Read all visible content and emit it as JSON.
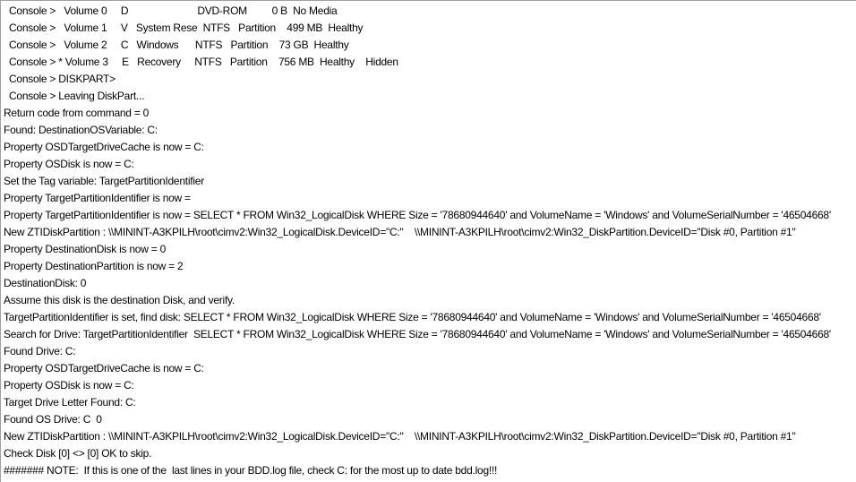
{
  "log_lines": [
    {
      "text": "Console >   Volume 0     D                         DVD-ROM         0 B  No Media",
      "console": true
    },
    {
      "text": "Console >   Volume 1     V   System Rese  NTFS   Partition    499 MB  Healthy",
      "console": true
    },
    {
      "text": "Console >   Volume 2     C   Windows      NTFS   Partition    73 GB  Healthy",
      "console": true
    },
    {
      "text": "Console > * Volume 3     E   Recovery     NTFS   Partition    756 MB  Healthy    Hidden",
      "console": true
    },
    {
      "text": "Console > DISKPART>",
      "console": true
    },
    {
      "text": "Console > Leaving DiskPart...",
      "console": true
    },
    {
      "text": "Return code from command = 0"
    },
    {
      "text": "Found: DestinationOSVariable: C:"
    },
    {
      "text": "Property OSDTargetDriveCache is now = C:"
    },
    {
      "text": "Property OSDisk is now = C:"
    },
    {
      "text": "Set the Tag variable: TargetPartitionIdentifier"
    },
    {
      "text": "Property TargetPartitionIdentifier is now = "
    },
    {
      "text": "Property TargetPartitionIdentifier is now = SELECT * FROM Win32_LogicalDisk WHERE Size = '78680944640' and VolumeName = 'Windows' and VolumeSerialNumber = '46504668'"
    },
    {
      "text": "New ZTIDiskPartition : \\\\MININT-A3KPILH\\root\\cimv2:Win32_LogicalDisk.DeviceID=\"C:\"    \\\\MININT-A3KPILH\\root\\cimv2:Win32_DiskPartition.DeviceID=\"Disk #0, Partition #1\""
    },
    {
      "text": "Property DestinationDisk is now = 0"
    },
    {
      "text": "Property DestinationPartition is now = 2"
    },
    {
      "text": "DestinationDisk: 0"
    },
    {
      "text": "Assume this disk is the destination Disk, and verify."
    },
    {
      "text": "TargetPartitionIdentifier is set, find disk: SELECT * FROM Win32_LogicalDisk WHERE Size = '78680944640' and VolumeName = 'Windows' and VolumeSerialNumber = '46504668'"
    },
    {
      "text": "Search for Drive: TargetPartitionIdentifier  SELECT * FROM Win32_LogicalDisk WHERE Size = '78680944640' and VolumeName = 'Windows' and VolumeSerialNumber = '46504668'"
    },
    {
      "text": "Found Drive: C:"
    },
    {
      "text": "Property OSDTargetDriveCache is now = C:"
    },
    {
      "text": "Property OSDisk is now = C:"
    },
    {
      "text": "Target Drive Letter Found: C:"
    },
    {
      "text": "Found OS Drive: C  0"
    },
    {
      "text": "New ZTIDiskPartition : \\\\MININT-A3KPILH\\root\\cimv2:Win32_LogicalDisk.DeviceID=\"C:\"    \\\\MININT-A3KPILH\\root\\cimv2:Win32_DiskPartition.DeviceID=\"Disk #0, Partition #1\""
    },
    {
      "text": "Check Disk [0] <> [0] OK to skip."
    },
    {
      "text": "####### NOTE:  If this is one of the  last lines in your BDD.log file, check C: for the most up to date bdd.log!!!"
    }
  ]
}
